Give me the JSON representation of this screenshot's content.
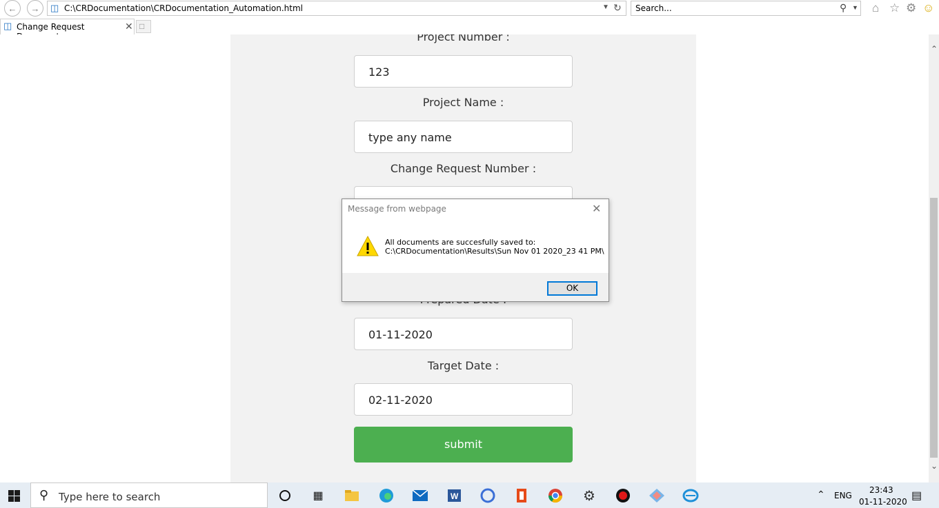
{
  "browser": {
    "address": "C:\\CRDocumentation\\CRDocumentation_Automation.html",
    "search_placeholder": "Search...",
    "tab_title": "Change Request Document...",
    "icons": [
      "back-icon",
      "forward-icon",
      "refresh-icon",
      "search-icon",
      "home-icon",
      "favorites-star-icon",
      "settings-gear-icon",
      "smiley-feedback-icon"
    ]
  },
  "form": {
    "project_number_label": "Project Number :",
    "project_number_value": "123",
    "project_name_label": "Project Name :",
    "project_name_value": "type any name",
    "cr_number_label": "Change Request Number :",
    "prepared_date_label": "Prepared Date :",
    "prepared_date_value": "01-11-2020",
    "target_date_label": "Target Date :",
    "target_date_value": "02-11-2020",
    "submit_label": "submit"
  },
  "dialog": {
    "title": "Message from webpage",
    "message_line1": "All documents are succesfully saved to:",
    "message_line2": "C:\\CRDocumentation\\Results\\Sun Nov 01 2020_23 41 PM\\",
    "ok_label": "OK"
  },
  "taskbar": {
    "search_placeholder": "Type here to search",
    "language": "ENG",
    "time": "23:43",
    "date": "01-11-2020"
  },
  "colors": {
    "submit_green": "#4caf50",
    "form_background": "#f2f2f2",
    "taskbar": "#e6edf4",
    "dialog_ok_border": "#0078d7"
  }
}
